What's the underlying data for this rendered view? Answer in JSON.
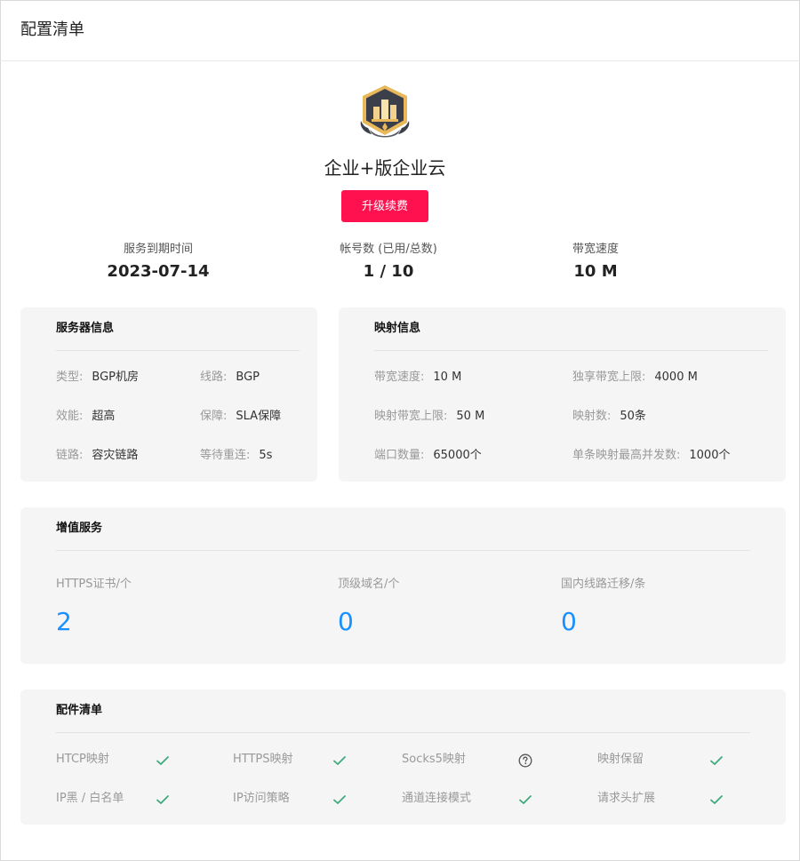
{
  "header": {
    "title": "配置清单"
  },
  "plan": {
    "name": "企业+版企业云",
    "upgrade_label": "升级续费"
  },
  "stats": [
    {
      "label": "服务到期时间",
      "value": "2023-07-14"
    },
    {
      "label": "帐号数 (已用/总数)",
      "value": "1 / 10"
    },
    {
      "label": "带宽速度",
      "value": "10 M"
    }
  ],
  "server_info": {
    "title": "服务器信息",
    "items": [
      {
        "key": "类型:",
        "value": "BGP机房"
      },
      {
        "key": "线路:",
        "value": "BGP"
      },
      {
        "key": "效能:",
        "value": "超高"
      },
      {
        "key": "保障:",
        "value": "SLA保障"
      },
      {
        "key": "链路:",
        "value": "容灾链路"
      },
      {
        "key": "等待重连:",
        "value": "5s"
      }
    ]
  },
  "mapping_info": {
    "title": "映射信息",
    "items": [
      {
        "key": "带宽速度:",
        "value": "10 M"
      },
      {
        "key": "独享带宽上限:",
        "value": "4000 M"
      },
      {
        "key": "映射带宽上限:",
        "value": "50 M"
      },
      {
        "key": "映射数:",
        "value": "50条"
      },
      {
        "key": "端口数量:",
        "value": "65000个"
      },
      {
        "key": "单条映射最高并发数:",
        "value": "1000个"
      }
    ]
  },
  "value_added": {
    "title": "增值服务",
    "items": [
      {
        "label": "HTTPS证书/个",
        "value": "2"
      },
      {
        "label": "顶级域名/个",
        "value": "0"
      },
      {
        "label": "国内线路迁移/条",
        "value": "0"
      }
    ]
  },
  "components": {
    "title": "配件清单",
    "items": [
      {
        "label": "HTCP映射",
        "icon": "check-icon"
      },
      {
        "label": "HTTPS映射",
        "icon": "check-icon"
      },
      {
        "label": "Socks5映射",
        "icon": "question-circle-icon"
      },
      {
        "label": "映射保留",
        "icon": "check-icon"
      },
      {
        "label": "IP黑 / 白名单",
        "icon": "check-icon"
      },
      {
        "label": "IP访问策略",
        "icon": "check-icon"
      },
      {
        "label": "通道连接模式",
        "icon": "check-icon"
      },
      {
        "label": "请求头扩展",
        "icon": "check-icon"
      }
    ]
  },
  "colors": {
    "accent_red": "#ff1150",
    "value_blue": "#1890ff",
    "check_green": "#3daa7e",
    "badge_gold": "#e8b85a",
    "badge_dark": "#3a3f4a"
  }
}
